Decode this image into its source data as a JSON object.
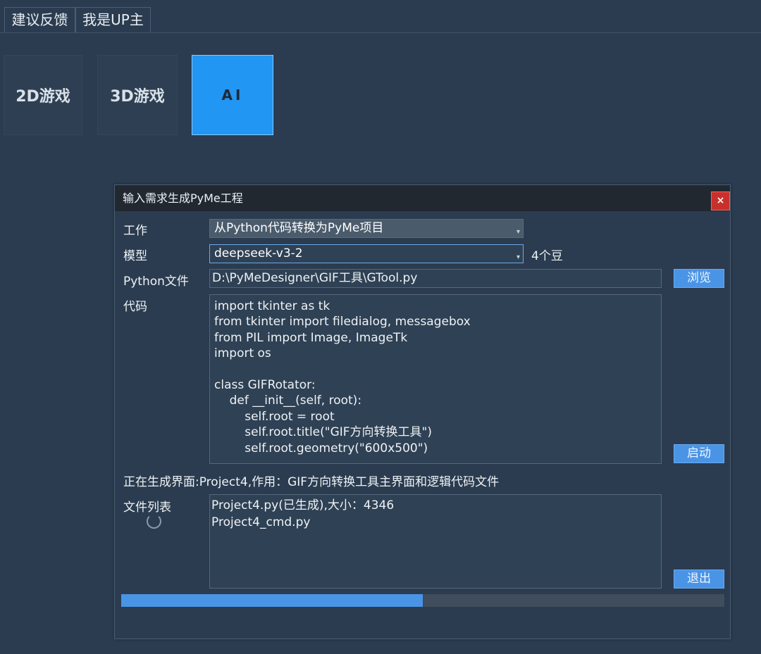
{
  "topmenu": {
    "items": [
      "建议反馈",
      "我是UP主"
    ]
  },
  "categories": [
    "2D游戏",
    "3D游戏",
    "AI"
  ],
  "dialog": {
    "title": "输入需求生成PyMe工程",
    "close_label": "×",
    "work_label": "工作",
    "work_value": "从Python代码转换为PyMe项目",
    "model_label": "模型",
    "model_value": "deepseek-v3-2",
    "beans_text": "4个豆",
    "pyfile_label": "Python文件",
    "pyfile_value": "D:\\PyMeDesigner\\GIF工具\\GTool.py",
    "browse_label": "浏览",
    "code_label": "代码",
    "code_lines": [
      "import tkinter as tk",
      "from tkinter import filedialog, messagebox",
      "from PIL import Image, ImageTk",
      "import os",
      "",
      "class GIFRotator:",
      "    def __init__(self, root):",
      "        self.root = root",
      "        self.root.title(\"GIF方向转换工具\")",
      "        self.root.geometry(\"600x500\")"
    ],
    "start_label": "启动",
    "status_text": "正在生成界面:Project4,作用：GIF方向转换工具主界面和逻辑代码文件",
    "filelist_label": "文件列表",
    "files": [
      "Project4.py(已生成),大小：4346",
      "Project4_cmd.py"
    ],
    "exit_label": "退出",
    "progress_percent": 50
  },
  "colors": {
    "accent": "#4a94e6",
    "selected_tile": "#2196f3",
    "close": "#c9302c",
    "background": "#2b3c50"
  },
  "icons": {
    "dropdown": "chevron-down-icon",
    "close": "close-icon",
    "busy": "spinner-icon"
  }
}
